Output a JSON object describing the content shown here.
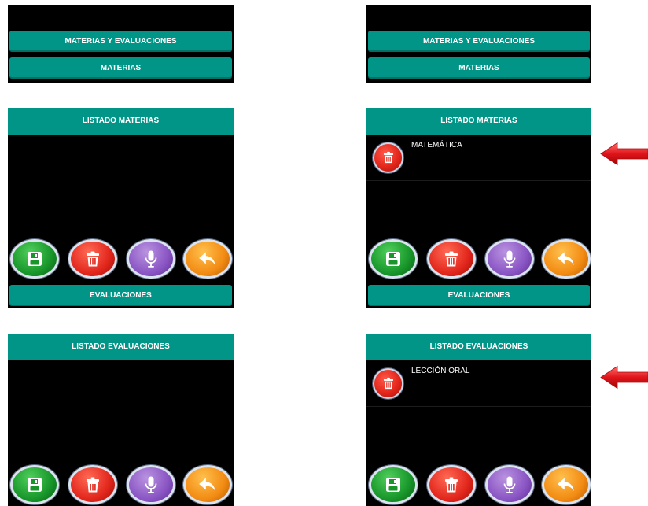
{
  "top_left": {
    "btn_materias_evaluaciones": "MATERIAS Y EVALUACIONES",
    "btn_materias": "MATERIAS",
    "input_value": "",
    "list_header": "LISTADO MATERIAS",
    "btn_evaluaciones": "EVALUACIONES"
  },
  "top_right": {
    "btn_materias_evaluaciones": "MATERIAS Y EVALUACIONES",
    "btn_materias": "MATERIAS",
    "input_value": "",
    "list_header": "LISTADO MATERIAS",
    "items": [
      {
        "label": "MATEMÁTICA"
      }
    ],
    "btn_evaluaciones": "EVALUACIONES"
  },
  "bottom_left": {
    "list_header": "LISTADO EVALUACIONES"
  },
  "bottom_right": {
    "list_header": "LISTADO EVALUACIONES",
    "items": [
      {
        "label": "LECCIÓN ORAL"
      }
    ]
  },
  "icons": {
    "save": "floppy-disk-icon",
    "delete": "trash-icon",
    "voice": "microphone-icon",
    "back": "undo-arrow-icon",
    "pointer": "left-arrow-icon"
  },
  "colors": {
    "accent": "#009587",
    "screen_bg": "#000000",
    "save": "#18962a",
    "delete": "#e2261c",
    "voice": "#8a55c4",
    "back": "#f28b13",
    "pointer_arrow": "#e0141a"
  }
}
